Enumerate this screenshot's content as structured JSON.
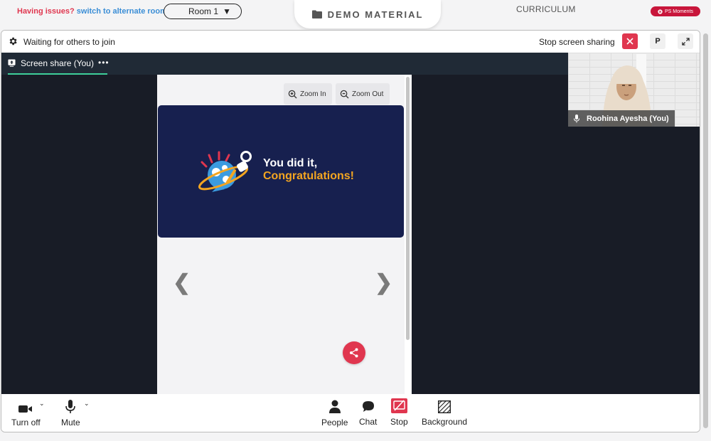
{
  "topbar": {
    "issues_text": "Having issues?",
    "switch_link": "switch to alternate room",
    "room_value": "Room 1",
    "demo_material": "DEMO MATERIAL",
    "curriculum": "CURRICULUM",
    "ps_moments": "PS Moments"
  },
  "header": {
    "status": "Waiting for others to join",
    "stop_sharing_label": "Stop screen sharing",
    "p_button": "P"
  },
  "tab": {
    "label": "Screen share (You)",
    "more": "•••"
  },
  "shared_screen": {
    "zoom_in": "Zoom In",
    "zoom_out": "Zoom Out",
    "slide_line1": "You did it,",
    "slide_line2": "Congratulations!",
    "prev": "❮",
    "next": "❯"
  },
  "self_video": {
    "name": "Roohina Ayesha (You)"
  },
  "controls": {
    "camera": "Turn off",
    "mic": "Mute",
    "people": "People",
    "chat": "Chat",
    "stop": "Stop",
    "background": "Background"
  },
  "colors": {
    "accent_red": "#e0364f",
    "tab_underline": "#3ecf9a",
    "slide_bg": "#17204f",
    "slide_highlight": "#f3a521"
  },
  "icons": [
    "folder-icon",
    "gear-icon",
    "close-icon",
    "expand-icon",
    "screen-share-icon",
    "zoom-in-icon",
    "zoom-out-icon",
    "share-icon",
    "microphone-icon",
    "video-camera-icon",
    "person-icon",
    "chat-bubble-icon",
    "stop-share-icon",
    "background-icon"
  ]
}
